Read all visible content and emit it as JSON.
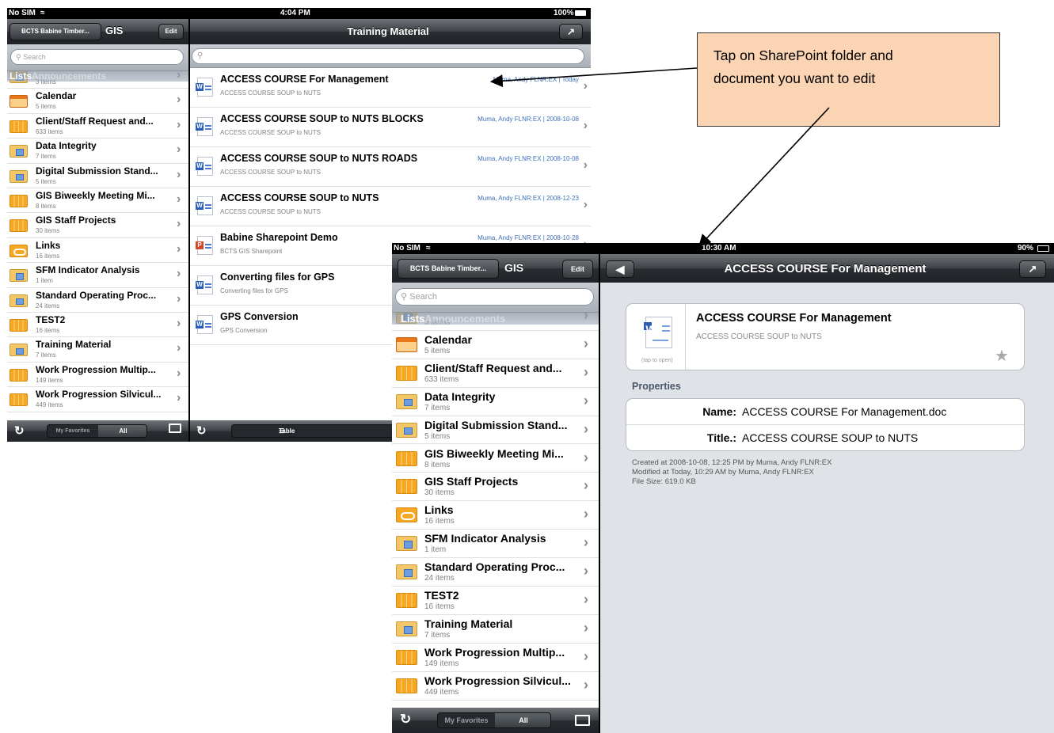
{
  "back_screen": {
    "status": {
      "carrier": "No SIM",
      "time": "4:04 PM",
      "battery": "100%"
    },
    "left_nav": {
      "back_label": "BCTS Babine Timber...",
      "title": "GIS",
      "edit_label": "Edit"
    },
    "main_nav": {
      "title": "Training Material"
    },
    "search": {
      "placeholder": "Search"
    },
    "section_label": "Lists",
    "section_ghost": "Announcements",
    "lists": [
      {
        "icon": "folder",
        "title": "",
        "count": "3 items"
      },
      {
        "icon": "calendar",
        "title": "Calendar",
        "count": "5 items"
      },
      {
        "icon": "table",
        "title": "Client/Staff Request and...",
        "count": "633 items"
      },
      {
        "icon": "folder",
        "title": "Data Integrity",
        "count": "7 items"
      },
      {
        "icon": "folder",
        "title": "Digital Submission Stand...",
        "count": "5 items"
      },
      {
        "icon": "table",
        "title": "GIS Biweekly Meeting Mi...",
        "count": "8 items"
      },
      {
        "icon": "table",
        "title": "GIS Staff Projects",
        "count": "30 items"
      },
      {
        "icon": "links",
        "title": "Links",
        "count": "16 items"
      },
      {
        "icon": "folder",
        "title": "SFM Indicator Analysis",
        "count": "1 item"
      },
      {
        "icon": "folder",
        "title": "Standard Operating Proc...",
        "count": "24 items"
      },
      {
        "icon": "table",
        "title": "TEST2",
        "count": "16 items"
      },
      {
        "icon": "folder",
        "title": "Training Material",
        "count": "7 items"
      },
      {
        "icon": "table",
        "title": "Work Progression Multip...",
        "count": "149 items"
      },
      {
        "icon": "table",
        "title": "Work Progression Silvicul...",
        "count": "449 items"
      }
    ],
    "documents": [
      {
        "icon": "word",
        "title": "ACCESS COURSE For Management",
        "sub": "ACCESS COURSE SOUP to NUTS",
        "meta": "Muma, Andy FLNR:EX | Today"
      },
      {
        "icon": "word",
        "title": "ACCESS COURSE SOUP to NUTS BLOCKS",
        "sub": "ACCESS COURSE SOUP to NUTS",
        "meta": "Muma, Andy FLNR:EX | 2008-10-08"
      },
      {
        "icon": "word",
        "title": "ACCESS COURSE SOUP to NUTS ROADS",
        "sub": "ACCESS COURSE SOUP to NUTS",
        "meta": "Muma, Andy FLNR:EX | 2008-10-08"
      },
      {
        "icon": "word",
        "title": "ACCESS COURSE SOUP to NUTS",
        "sub": "ACCESS COURSE SOUP to NUTS",
        "meta": "Muma, Andy FLNR:EX | 2008-12-23"
      },
      {
        "icon": "ppt",
        "title": "Babine Sharepoint Demo",
        "sub": "BCTS GIS Sharepoint",
        "meta": "Muma, Andy FLNR:EX | 2008-10-28"
      },
      {
        "icon": "word",
        "title": "Converting files for GPS",
        "sub": "Converting files for GPS",
        "meta": ""
      },
      {
        "icon": "word",
        "title": "GPS Conversion",
        "sub": "GPS Conversion",
        "meta": ""
      }
    ],
    "left_toolbar": {
      "tab_favorites": "My Favorites",
      "tab_all": "All"
    },
    "main_toolbar": {
      "table_label": "Table",
      "all_docs_label": "All Docu"
    }
  },
  "front_screen": {
    "status": {
      "carrier": "No SIM",
      "time": "10:30 AM",
      "battery": "90%"
    },
    "left_nav": {
      "back_label": "BCTS Babine Timber...",
      "title": "GIS",
      "edit_label": "Edit"
    },
    "main_nav": {
      "title": "ACCESS COURSE For Management"
    },
    "search": {
      "placeholder": "Search"
    },
    "section_label": "Lists",
    "section_ghost": "Announcements",
    "lists": [
      {
        "icon": "folder",
        "title": "",
        "count": "3 items"
      },
      {
        "icon": "calendar",
        "title": "Calendar",
        "count": "5 items"
      },
      {
        "icon": "table",
        "title": "Client/Staff Request and...",
        "count": "633 items"
      },
      {
        "icon": "folder",
        "title": "Data Integrity",
        "count": "7 items"
      },
      {
        "icon": "folder",
        "title": "Digital Submission Stand...",
        "count": "5 items"
      },
      {
        "icon": "table",
        "title": "GIS Biweekly Meeting Mi...",
        "count": "8 items"
      },
      {
        "icon": "table",
        "title": "GIS Staff Projects",
        "count": "30 items"
      },
      {
        "icon": "links",
        "title": "Links",
        "count": "16 items"
      },
      {
        "icon": "folder",
        "title": "SFM Indicator Analysis",
        "count": "1 item"
      },
      {
        "icon": "folder",
        "title": "Standard Operating Proc...",
        "count": "24 items"
      },
      {
        "icon": "table",
        "title": "TEST2",
        "count": "16 items"
      },
      {
        "icon": "folder",
        "title": "Training Material",
        "count": "7 items"
      },
      {
        "icon": "table",
        "title": "Work Progression Multip...",
        "count": "149 items"
      },
      {
        "icon": "table",
        "title": "Work Progression Silvicul...",
        "count": "449 items"
      }
    ],
    "detail": {
      "doc_title": "ACCESS COURSE For Management",
      "doc_subtitle": "ACCESS COURSE SOUP to NUTS",
      "tap_hint": "(tap to open)",
      "properties_header": "Properties",
      "name_label": "Name:",
      "name_value": "ACCESS COURSE For Management.doc",
      "title_label": "Title.:",
      "title_value": "ACCESS COURSE SOUP to NUTS",
      "created": "Created at 2008-10-08, 12:25 PM by Muma, Andy FLNR:EX",
      "modified": "Modified at Today, 10:29 AM by Muma, Andy FLNR:EX",
      "file_size": "File Size: 619.0 KB"
    },
    "left_toolbar": {
      "tab_favorites": "My Favorites",
      "tab_all": "All"
    }
  },
  "callout": {
    "line1": "Tap on SharePoint folder and",
    "line2": "document you want to edit"
  }
}
